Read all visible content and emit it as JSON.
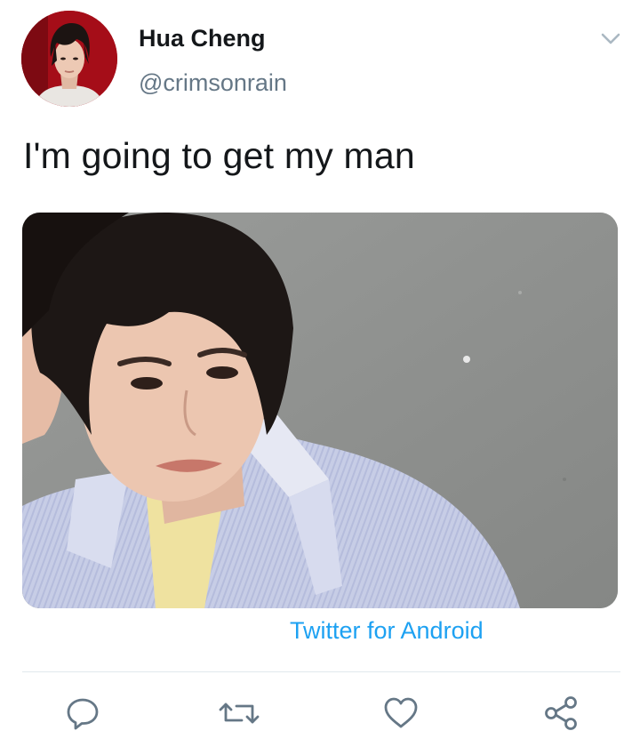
{
  "tweet": {
    "author": {
      "display_name": "Hua Cheng",
      "handle": "@crimsonrain",
      "avatar": "avatar-photo"
    },
    "text": "I'm going to get my man",
    "media": "photo-young-man-striped-shirt-grey-wall",
    "source": "Twitter for Android",
    "menu_icon": "chevron-down-icon"
  },
  "actions": [
    {
      "name": "reply",
      "icon": "reply-icon"
    },
    {
      "name": "retweet",
      "icon": "retweet-icon"
    },
    {
      "name": "like",
      "icon": "heart-icon"
    },
    {
      "name": "share",
      "icon": "share-icon"
    }
  ],
  "colors": {
    "text": "#14171a",
    "secondary": "#657786",
    "link": "#1da1f2",
    "divider": "#e1e8ed",
    "icon": "#657786"
  }
}
